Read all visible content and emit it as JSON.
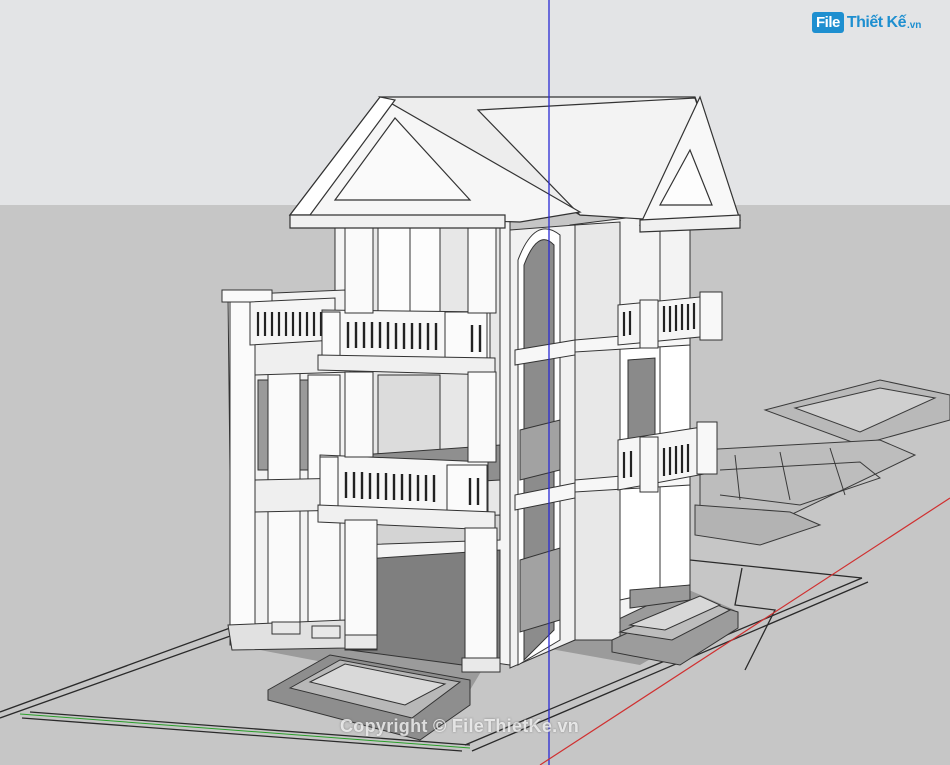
{
  "app": {
    "name": "SketchUp 3D viewport"
  },
  "colors": {
    "sky": "#e3e4e6",
    "ground": "#c6c6c6",
    "wall": "#f2f2f2",
    "shadow": "#a9a9a9",
    "dark_floor": "#7b7b7b",
    "roof": "#ececec",
    "blue_axis": "#2a2ad4",
    "red_axis": "#d03030",
    "green_axis": "#2aa02a",
    "logo_blue": "#1e8fd0"
  },
  "logo": {
    "box_text": "File",
    "rest_text": "Thiết Kế",
    "suffix": ".vn"
  },
  "watermark": {
    "text": "Copyright © FileThietKe.vn"
  }
}
